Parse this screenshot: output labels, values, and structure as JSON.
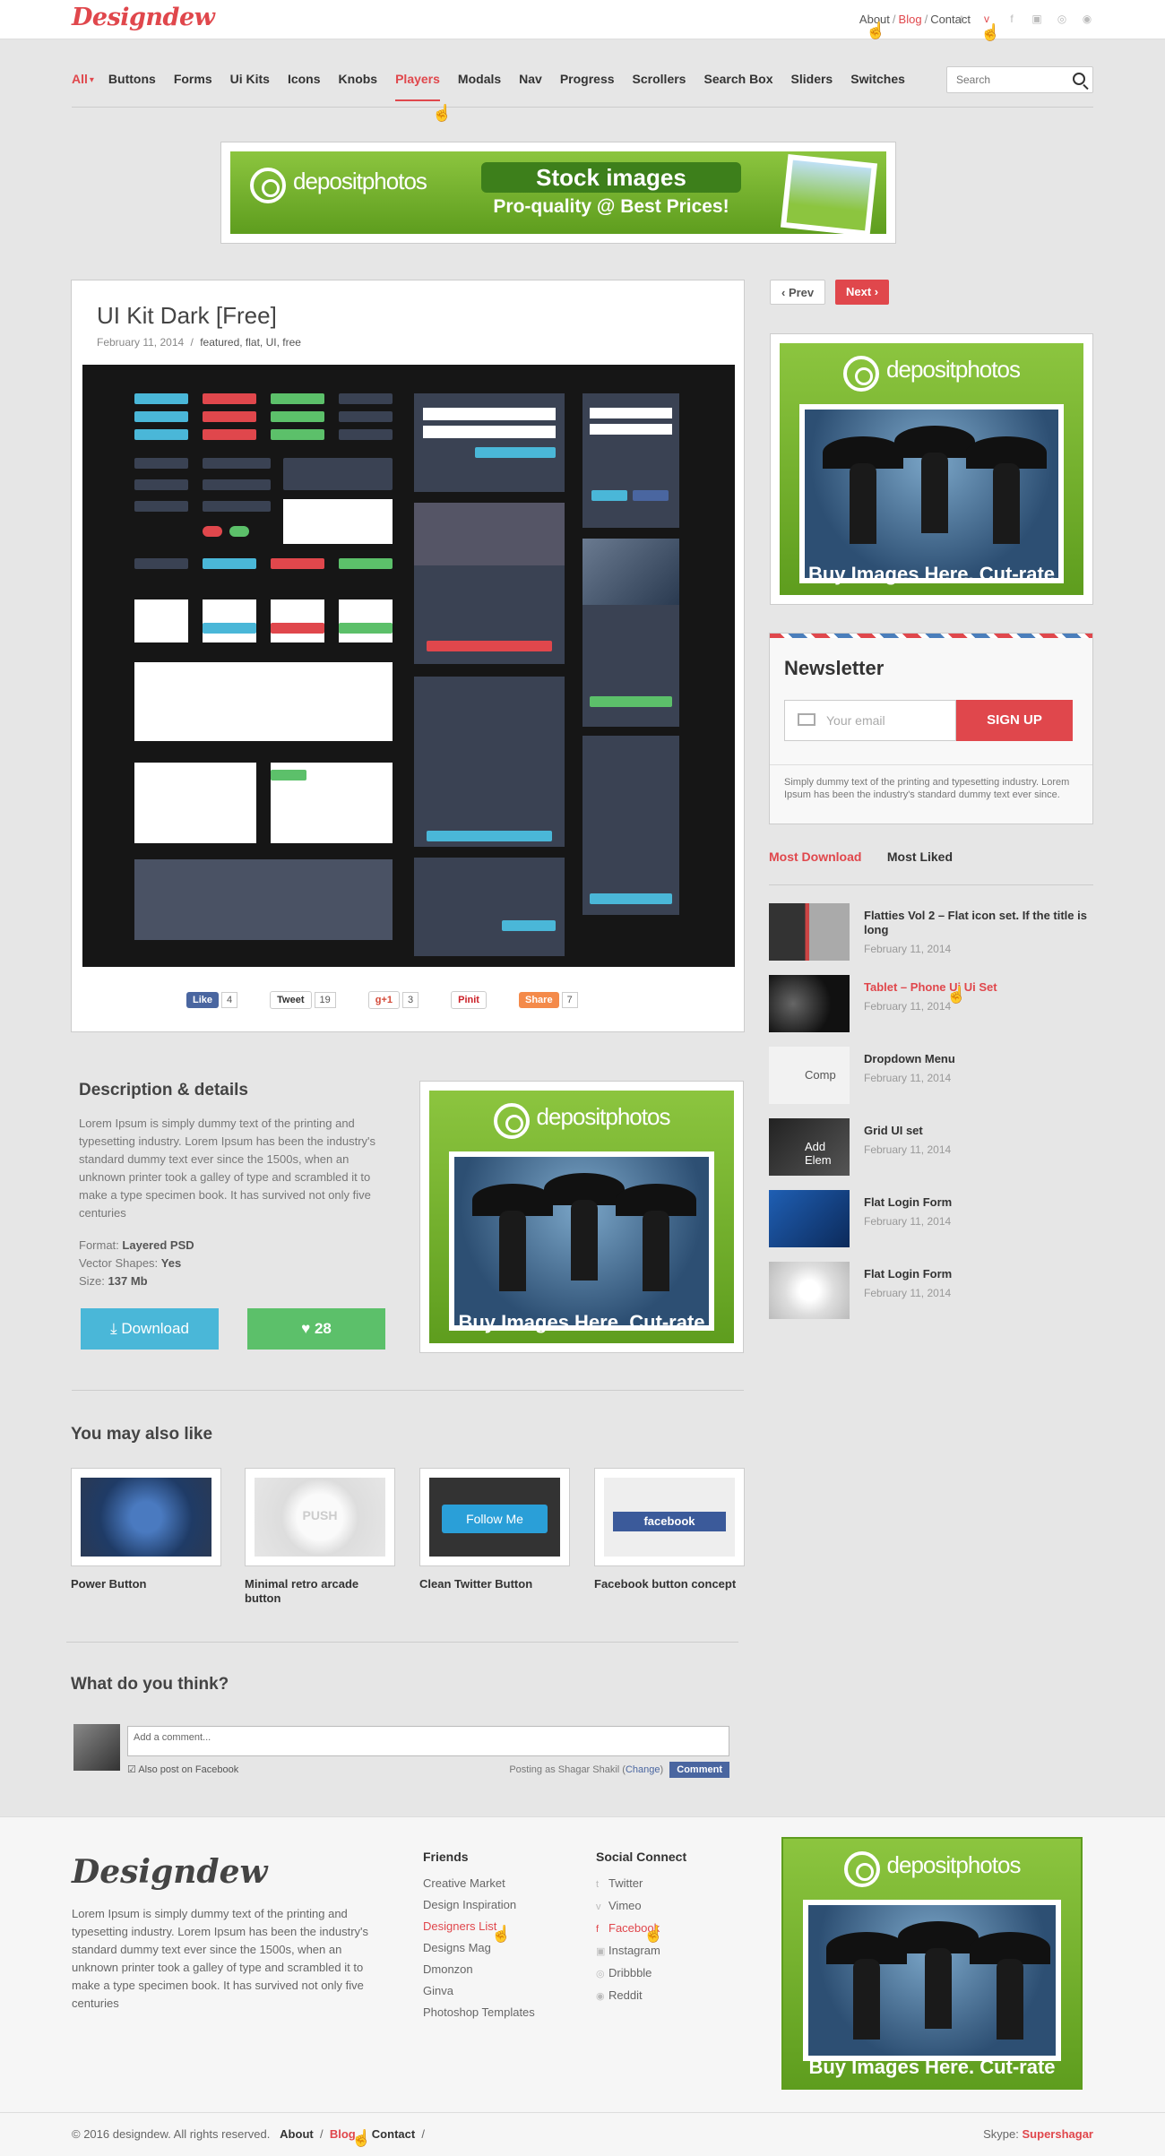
{
  "brand": {
    "logo": "Designdew",
    "accent": "#e0474c"
  },
  "toplinks": {
    "about": "About",
    "blog": "Blog",
    "contact": "Contact",
    "sep": "/"
  },
  "social_top": [
    "twitter-icon",
    "vimeo-icon",
    "facebook-icon",
    "instagram-icon",
    "dribbble-icon",
    "reddit-icon"
  ],
  "categories": [
    "All",
    "Buttons",
    "Forms",
    "Ui Kits",
    "Icons",
    "Knobs",
    "Players",
    "Modals",
    "Nav",
    "Progress",
    "Scrollers",
    "Search Box",
    "Sliders",
    "Switches"
  ],
  "search": {
    "placeholder": "Search"
  },
  "banner_ad": {
    "brand": "depositphotos",
    "headline": "Stock images",
    "sub": "Pro-quality @ Best Prices!"
  },
  "square_ad": {
    "brand": "depositphotos",
    "tagline": "Buy Images Here. Cut-rate"
  },
  "post": {
    "title": "UI Kit Dark [Free]",
    "date": "February 11, 2014",
    "sep": "/",
    "tags": "featured, flat, UI, free"
  },
  "share": {
    "like": "Like",
    "like_count": "4",
    "tweet": "Tweet",
    "tweet_count": "19",
    "gplus": "g+1",
    "gplus_count": "3",
    "pinit": "Pinit",
    "share": "Share",
    "share_count": "7"
  },
  "pager": {
    "prev": "Prev",
    "next": "Next"
  },
  "newsletter": {
    "title": "Newsletter",
    "placeholder": "Your email",
    "button": "SIGN UP",
    "note": "Simply dummy text of the printing and typesetting industry. Lorem Ipsum has been the industry's standard dummy text ever since."
  },
  "tabs": {
    "most_download": "Most Download",
    "most_liked": "Most Liked"
  },
  "side_items": [
    {
      "title": "Flatties Vol 2 – Flat icon set. If the title is long",
      "date": "February 11, 2014"
    },
    {
      "title": "Tablet – Phone Ui Ui Set",
      "date": "February 11, 2014"
    },
    {
      "title": "Dropdown Menu",
      "date": "February 11, 2014",
      "thumb_text": "Comp"
    },
    {
      "title": "Grid UI set",
      "date": "February 11, 2014",
      "thumb_text": "Add Elem"
    },
    {
      "title": "Flat Login Form",
      "date": "February 11, 2014"
    },
    {
      "title": "Flat Login Form",
      "date": "February 11, 2014"
    }
  ],
  "description": {
    "heading": "Description & details",
    "text": "Lorem Ipsum is simply dummy text of the printing and typesetting industry. Lorem Ipsum has been the industry's standard dummy text ever since the 1500s, when an unknown printer took a galley of type and scrambled it to make a type specimen book. It has survived not only five centuries",
    "format_label": "Format:",
    "format_value": "Layered PSD",
    "vector_label": "Vector Shapes:",
    "vector_value": "Yes",
    "size_label": "Size:",
    "size_value": "137 Mb",
    "download": "Download",
    "likes": "28"
  },
  "related": {
    "heading": "You may also like",
    "items": [
      {
        "name": "Power Button"
      },
      {
        "name": "Minimal retro arcade button",
        "thumb_text": "PUSH"
      },
      {
        "name": "Clean Twitter Button",
        "thumb_text": "Follow Me"
      },
      {
        "name": "Facebook button concept",
        "thumb_text": "facebook"
      }
    ]
  },
  "comments": {
    "heading": "What do you think?",
    "placeholder": "Add a comment...",
    "also_post": "Also post on Facebook",
    "posting_as": "Posting as Shagar Shakil",
    "change": "Change",
    "button": "Comment"
  },
  "footer": {
    "logo": "Designdew",
    "text": "Lorem Ipsum is simply dummy text of the printing and typesetting industry. Lorem Ipsum has been the industry's standard dummy text ever since the 1500s, when an unknown printer took a galley of type and scrambled it to make a type specimen book. It has survived not only five centuries",
    "friends_heading": "Friends",
    "friends": [
      "Creative Market",
      "Design Inspiration",
      "Designers List",
      "Designs Mag",
      "Dmonzon",
      "Ginva",
      "Photoshop Templates"
    ],
    "social_heading": "Social Connect",
    "social": [
      "Twitter",
      "Vimeo",
      "Facebook",
      "Instagram",
      "Dribbble",
      "Reddit"
    ]
  },
  "bottom": {
    "copyright": "© 2016 designdew.  All rights reserved.",
    "about": "About",
    "blog": "Blog",
    "contact": "Contact",
    "sep": "/",
    "skype_label": "Skype:",
    "skype": "Supershagar"
  }
}
